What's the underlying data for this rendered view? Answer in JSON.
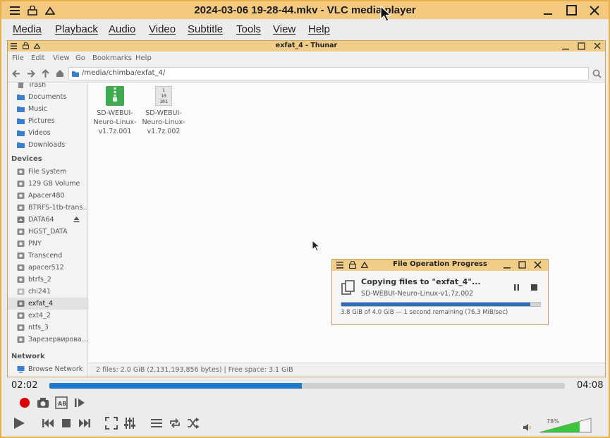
{
  "vlc": {
    "title": "2024-03-06 19-28-44.mkv - VLC media player",
    "menu": [
      "Media",
      "Playback",
      "Audio",
      "Video",
      "Subtitle",
      "Tools",
      "View",
      "Help"
    ],
    "time_elapsed": "02:02",
    "time_total": "04:08",
    "seek_fraction": 0.49,
    "volume_label": "78%",
    "volume_fraction": 0.78,
    "accent_color": "#1f78c8"
  },
  "thunar": {
    "title": "exfat_4 - Thunar",
    "menu": [
      "File",
      "Edit",
      "View",
      "Go",
      "Bookmarks",
      "Help"
    ],
    "path": "/media/chimba/exfat_4/",
    "sidebar": {
      "places": [
        "Trash",
        "Documents",
        "Music",
        "Pictures",
        "Videos",
        "Downloads"
      ],
      "devices_heading": "Devices",
      "devices": [
        "File System",
        "129 GB Volume",
        "Apacer480",
        "BTRFS-1tb-trans...",
        "DATA64",
        "HGST_DATA",
        "PNY",
        "Transcend",
        "apacer512",
        "btrfs_2",
        "chi241",
        "exfat_4",
        "ext4_2",
        "ntfs_3",
        "Зарезервирова..."
      ],
      "selected": "exfat_4",
      "network_heading": "Network",
      "network": [
        "Browse Network"
      ]
    },
    "files": [
      {
        "name": "SD-WEBUI-Neuro-Linux-v1.7z.001",
        "lines": [
          "SD-WEBUI-",
          "Neuro-Linux-",
          "v1.7z.001"
        ],
        "icon": "archive-icon"
      },
      {
        "name": "SD-WEBUI-Neuro-Linux-v1.7z.002",
        "lines": [
          "SD-WEBUI-",
          "Neuro-Linux-",
          "v1.7z.002"
        ],
        "icon": "binary-file-icon",
        "icon_text": [
          "1",
          "10",
          "101"
        ]
      }
    ],
    "status": "2 files: 2.0 GiB (2,131,193,856 bytes)  |  Free space: 3.1 GiB"
  },
  "progress_dialog": {
    "title": "File Operation Progress",
    "heading": "Copying files to \"exfat_4\"...",
    "current_file": "SD-WEBUI-Neuro-Linux-v1.7z.002",
    "progress_fraction": 0.95,
    "status": "3.8 GiB of 4.0 GiB — 1 second remaining (76.3 MiB/sec)"
  }
}
